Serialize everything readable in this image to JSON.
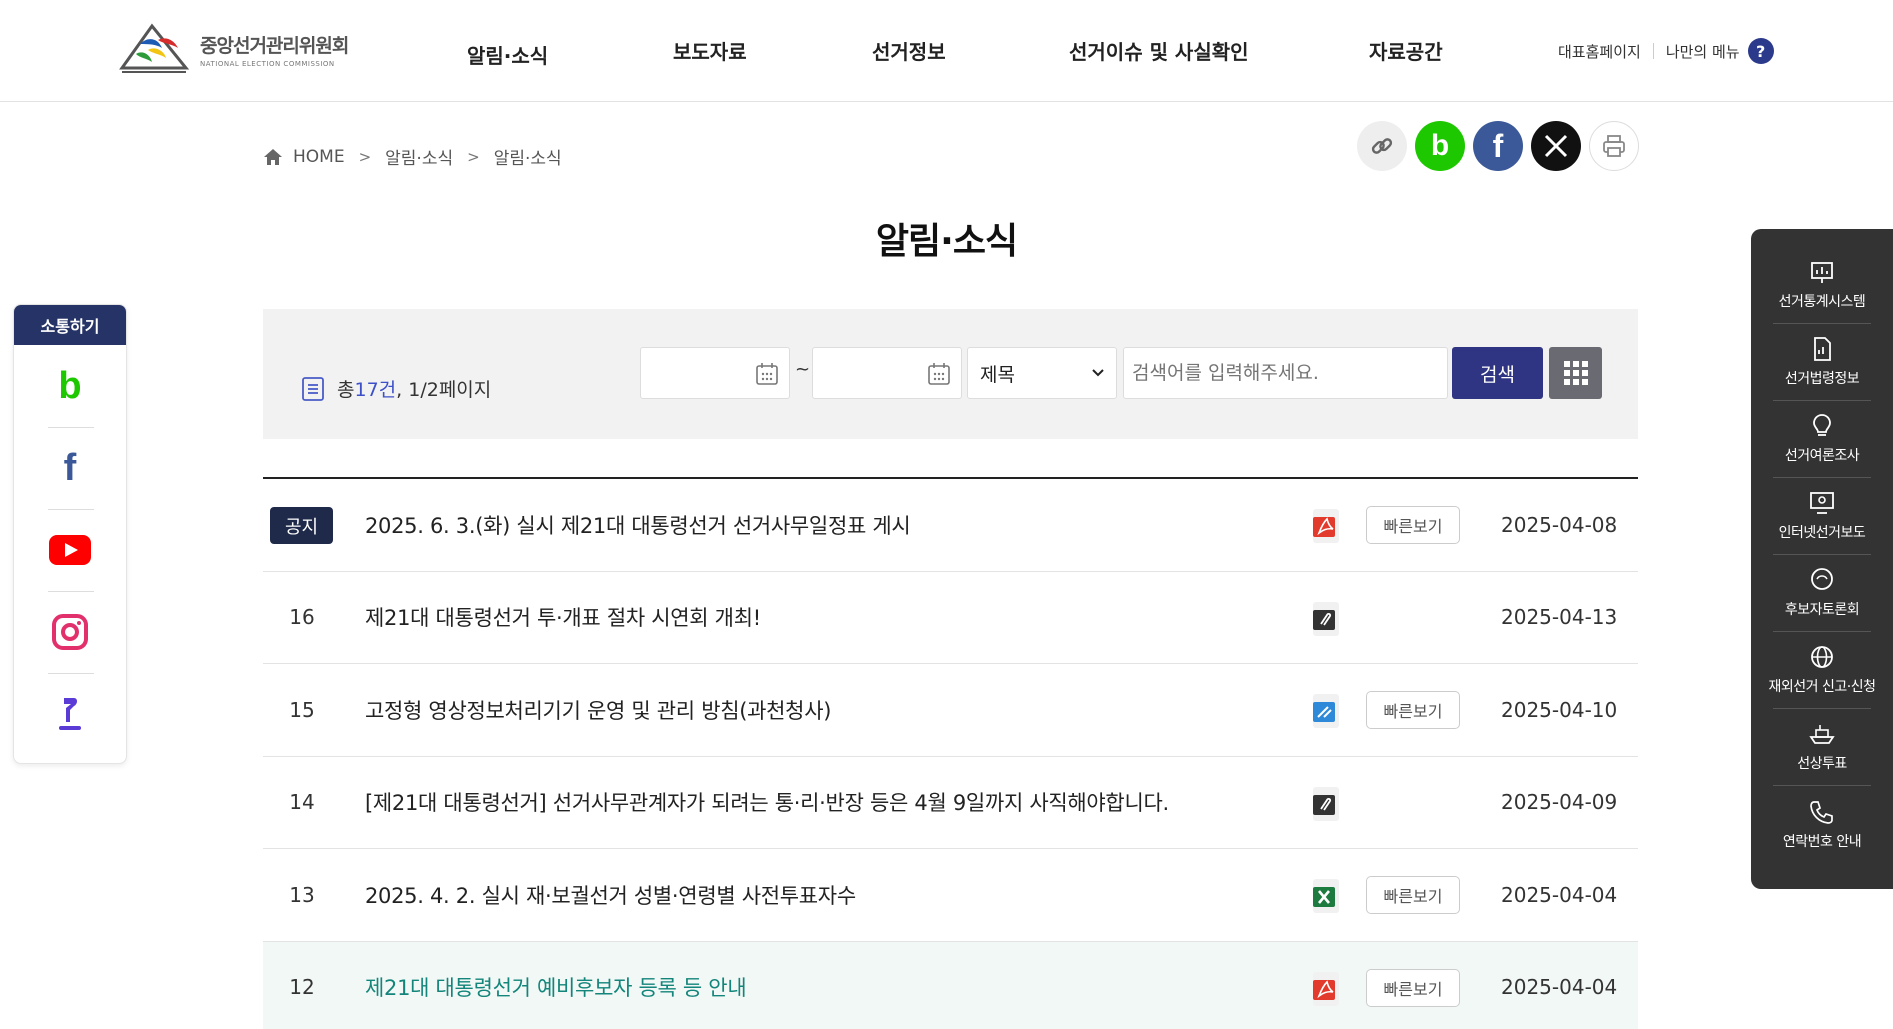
{
  "header": {
    "logo": {
      "name_ko": "중앙선거관리위원회",
      "name_en": "NATIONAL ELECTION COMMISSION"
    },
    "nav": [
      "알림·소식",
      "보도자료",
      "선거정보",
      "선거이슈 및 사실확인",
      "자료공간"
    ],
    "util": {
      "main_home": "대표홈페이지",
      "my_menu": "나만의 메뉴",
      "help": "?"
    }
  },
  "breadcrumb": [
    "HOME",
    "알림·소식",
    "알림·소식"
  ],
  "share": [
    {
      "name": "link-icon",
      "color": "#eeeeee"
    },
    {
      "name": "band-icon",
      "color": "#1ec800",
      "glyph": "b"
    },
    {
      "name": "facebook-icon",
      "color": "#3b5998",
      "glyph": "f"
    },
    {
      "name": "x-icon",
      "color": "#111111",
      "glyph": "X"
    },
    {
      "name": "print-icon",
      "color": "#ffffff"
    }
  ],
  "page_title": "알림·소식",
  "search": {
    "total_prefix": "총 ",
    "total_count": "17건",
    "total_pages": ", 1/2페이지",
    "tilde": "~",
    "field": "제목",
    "keyword_placeholder": "검색어를 입력해주세요.",
    "search_button": "검색"
  },
  "list": [
    {
      "num": "",
      "badge": "공지",
      "title": "2025. 6. 3.(화) 실시 제21대 대통령선거 선거사무일정표 게시",
      "file": "pdf",
      "quick": "빠른보기",
      "date": "2025-04-08"
    },
    {
      "num": "16",
      "badge": "",
      "title": "제21대 대통령선거 투·개표 절차 시연회 개최!",
      "file": "attach",
      "quick": "",
      "date": "2025-04-13"
    },
    {
      "num": "15",
      "badge": "",
      "title": "고정형 영상정보처리기기 운영 및 관리 방침(과천청사)",
      "file": "hwp",
      "quick": "빠른보기",
      "date": "2025-04-10"
    },
    {
      "num": "14",
      "badge": "",
      "title": "[제21대 대통령선거] 선거사무관계자가 되려는 통·리·반장 등은 4월 9일까지 사직해야합니다.",
      "file": "attach",
      "quick": "",
      "date": "2025-04-09"
    },
    {
      "num": "13",
      "badge": "",
      "title": "2025. 4. 2. 실시 재·보궐선거 성별·연령별 사전투표자수",
      "file": "xls",
      "quick": "빠른보기",
      "date": "2025-04-04"
    },
    {
      "num": "12",
      "badge": "",
      "title": "제21대 대통령선거 예비후보자 등록 등 안내",
      "file": "pdf",
      "quick": "빠른보기",
      "date": "2025-04-04"
    }
  ],
  "social": {
    "title": "소통하기",
    "items": [
      "band-icon",
      "facebook-icon",
      "youtube-icon",
      "instagram-icon",
      "blog-icon"
    ]
  },
  "quick_menu": [
    {
      "label": "선거통계시스템",
      "icon": "chart-board-icon"
    },
    {
      "label": "선거법령정보",
      "icon": "document-icon"
    },
    {
      "label": "선거여론조사",
      "icon": "lightbulb-icon"
    },
    {
      "label": "인터넷선거보도",
      "icon": "monitor-icon"
    },
    {
      "label": "후보자토론회",
      "icon": "discussion-icon"
    },
    {
      "label": "재외선거 신고·신청",
      "icon": "globe-icon"
    },
    {
      "label": "선상투표",
      "icon": "ship-icon"
    },
    {
      "label": "연락번호 안내",
      "icon": "phone-icon"
    }
  ]
}
